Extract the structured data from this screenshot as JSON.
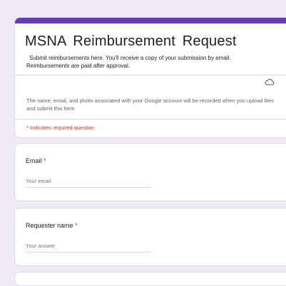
{
  "form": {
    "title": "MSNA  Reimbursement Request",
    "description_line1": "Submit reimbursements here. You'll receive a copy of your submission by email.",
    "description_line2": "Reimbursements are paid after approval.",
    "account_notice": "The name, email, and photo associated with your Google account will be recorded when you upload files and submit this form",
    "required_note": "* Indicates required question",
    "accent_color": "#673ab7",
    "cloud_icon": "cloud-icon"
  },
  "questions": [
    {
      "label": "Email",
      "required_mark": "*",
      "placeholder": "Your email"
    },
    {
      "label": "Requester name",
      "required_mark": "*",
      "placeholder": "Your answer"
    }
  ]
}
